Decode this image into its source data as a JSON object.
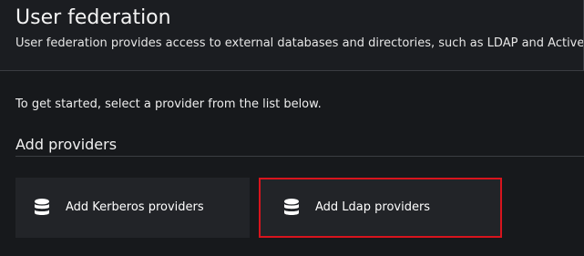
{
  "header": {
    "title": "User federation",
    "subtitle": "User federation provides access to external databases and directories, such as LDAP and Active D"
  },
  "main": {
    "intro_text": "To get started, select a provider from the list below.",
    "section_title": "Add providers",
    "providers": [
      {
        "label": "Add Kerberos providers",
        "icon": "database-icon"
      },
      {
        "label": "Add Ldap providers",
        "icon": "database-icon"
      }
    ]
  },
  "colors": {
    "highlight_border": "#d8141d",
    "card_background": "#222428",
    "page_background": "#17191c"
  }
}
